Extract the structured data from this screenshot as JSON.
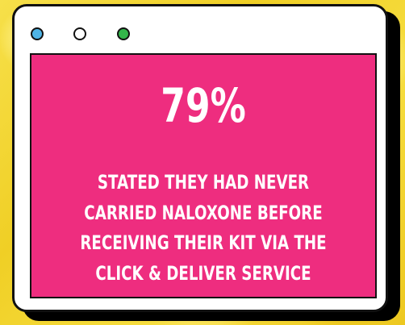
{
  "stat": "79%",
  "lines": [
    "STATED THEY HAD NEVER",
    "CARRIED NALOXONE BEFORE",
    "RECEIVING THEIR KIT VIA THE",
    "CLICK & DELIVER SERVICE"
  ],
  "colors": {
    "background": "#f3d530",
    "panel": "#ee2d7f",
    "text": "#ffffff",
    "dot_blue": "#4fb4e6",
    "dot_green": "#33b54a"
  }
}
